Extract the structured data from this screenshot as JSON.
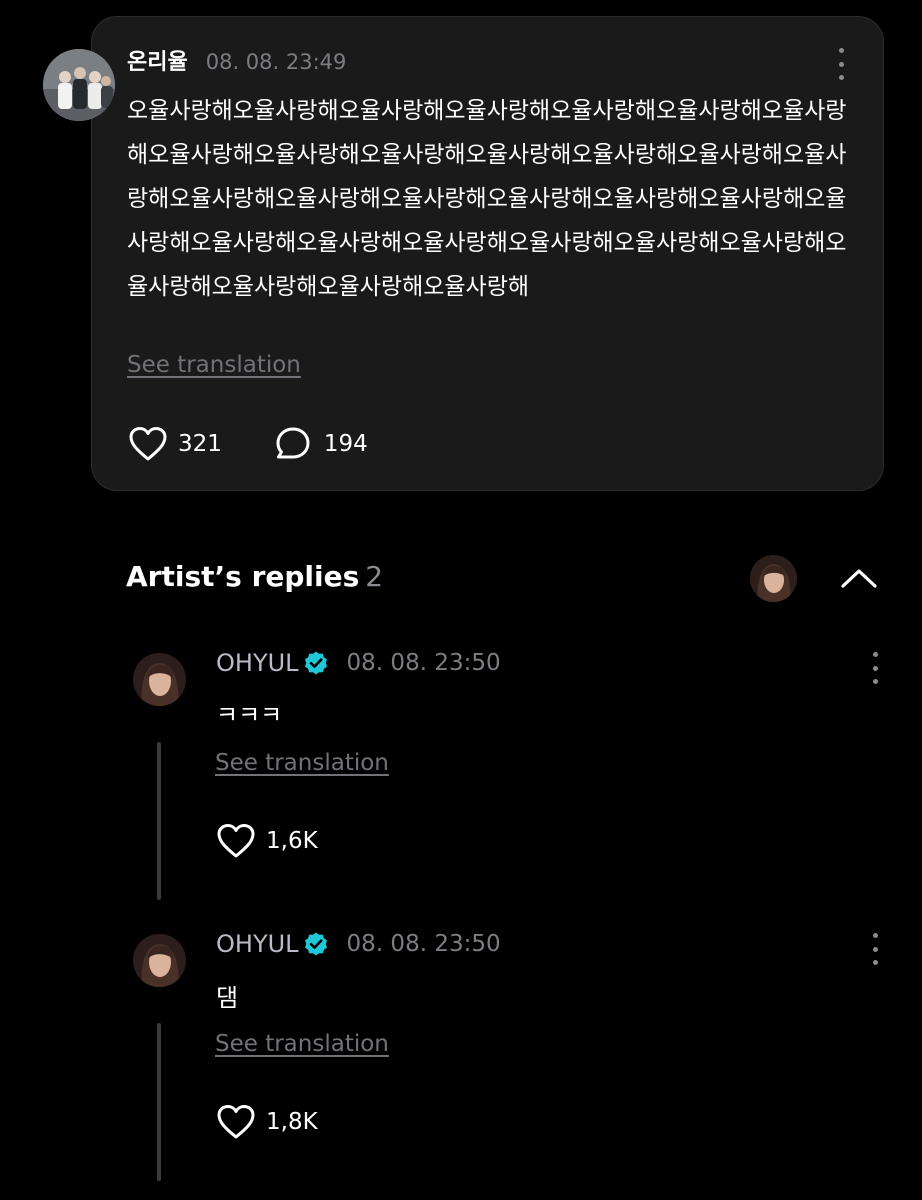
{
  "post": {
    "author": "온리율",
    "timestamp": "08. 08. 23:49",
    "body": "오율사랑해오율사랑해오율사랑해오율사랑해오율사랑해오율사랑해오율사랑해오율사랑해오율사랑해오율사랑해오율사랑해오율사랑해오율사랑해오율사랑해오율사랑해오율사랑해오율사랑해오율사랑해오율사랑해오율사랑해오율사랑해오율사랑해오율사랑해오율사랑해오율사랑해오율사랑해오율사랑해오율사랑해오율사랑해오율사랑해오율사랑해",
    "translate_label": "See translation",
    "likes": "321",
    "comments": "194",
    "icons": {
      "like": "heart-icon",
      "comment": "speech-bubble-icon",
      "menu": "more-vertical-icon"
    }
  },
  "artist_replies": {
    "title": "Artist’s replies",
    "count": "2",
    "collapse_icon": "chevron-up-icon",
    "replies": [
      {
        "author": "OHYUL",
        "verified_icon": "verified-badge-icon",
        "timestamp": "08. 08. 23:50",
        "text": "ㅋㅋㅋ",
        "translate_label": "See translation",
        "likes": "1,6K"
      },
      {
        "author": "OHYUL",
        "verified_icon": "verified-badge-icon",
        "timestamp": "08. 08. 23:50",
        "text": "댐",
        "translate_label": "See translation",
        "likes": "1,8K"
      }
    ]
  },
  "colors": {
    "background": "#000000",
    "card": "#1a1a1b",
    "secondary_text": "#7d7d82",
    "artist_name": "#b8bcc8",
    "verified": "#1ec8d8"
  }
}
